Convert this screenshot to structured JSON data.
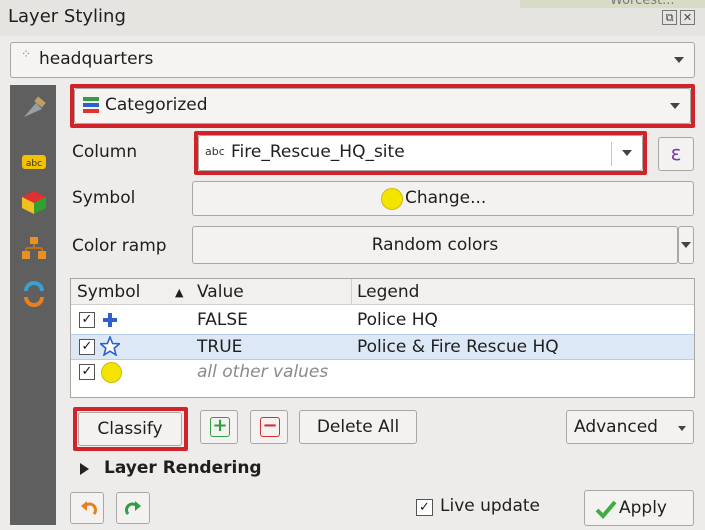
{
  "window": {
    "title": "Layer Styling",
    "map_fragment": "Worcest..."
  },
  "layer_select": {
    "value": "headquarters"
  },
  "renderer_select": {
    "value": "Categorized"
  },
  "column": {
    "label": "Column",
    "type_badge": "abc",
    "value": "Fire_Rescue_HQ_site",
    "expr_button": "ε"
  },
  "symbol": {
    "label": "Symbol",
    "button": "Change..."
  },
  "color_ramp": {
    "label": "Color ramp",
    "value": "Random colors"
  },
  "table": {
    "headers": {
      "symbol": "Symbol",
      "sort_indicator": "▲",
      "value": "Value",
      "legend": "Legend"
    },
    "rows": [
      {
        "checked": "✓",
        "symbol_icon": "cross-plus",
        "value": "FALSE",
        "legend": "Police HQ"
      },
      {
        "checked": "✓",
        "symbol_icon": "star-outline",
        "value": "TRUE",
        "legend": "Police & Fire Rescue HQ"
      },
      {
        "checked": "✓",
        "symbol_icon": "yellow-circle",
        "value": "all other values",
        "legend": ""
      }
    ]
  },
  "buttons": {
    "classify": "Classify",
    "add_symbol": "+",
    "remove_symbol": "−",
    "delete_all": "Delete All",
    "advanced": "Advanced"
  },
  "layer_rendering": {
    "label": "Layer Rendering"
  },
  "footer": {
    "live_update_check": "✓",
    "live_update": "Live update",
    "apply": "Apply"
  },
  "colors": {
    "highlight_red": "#d2232a",
    "symbol_blue": "#2d5fd0",
    "symbol_yellow": "#f5e400",
    "selected_row": "#dce8f6"
  }
}
